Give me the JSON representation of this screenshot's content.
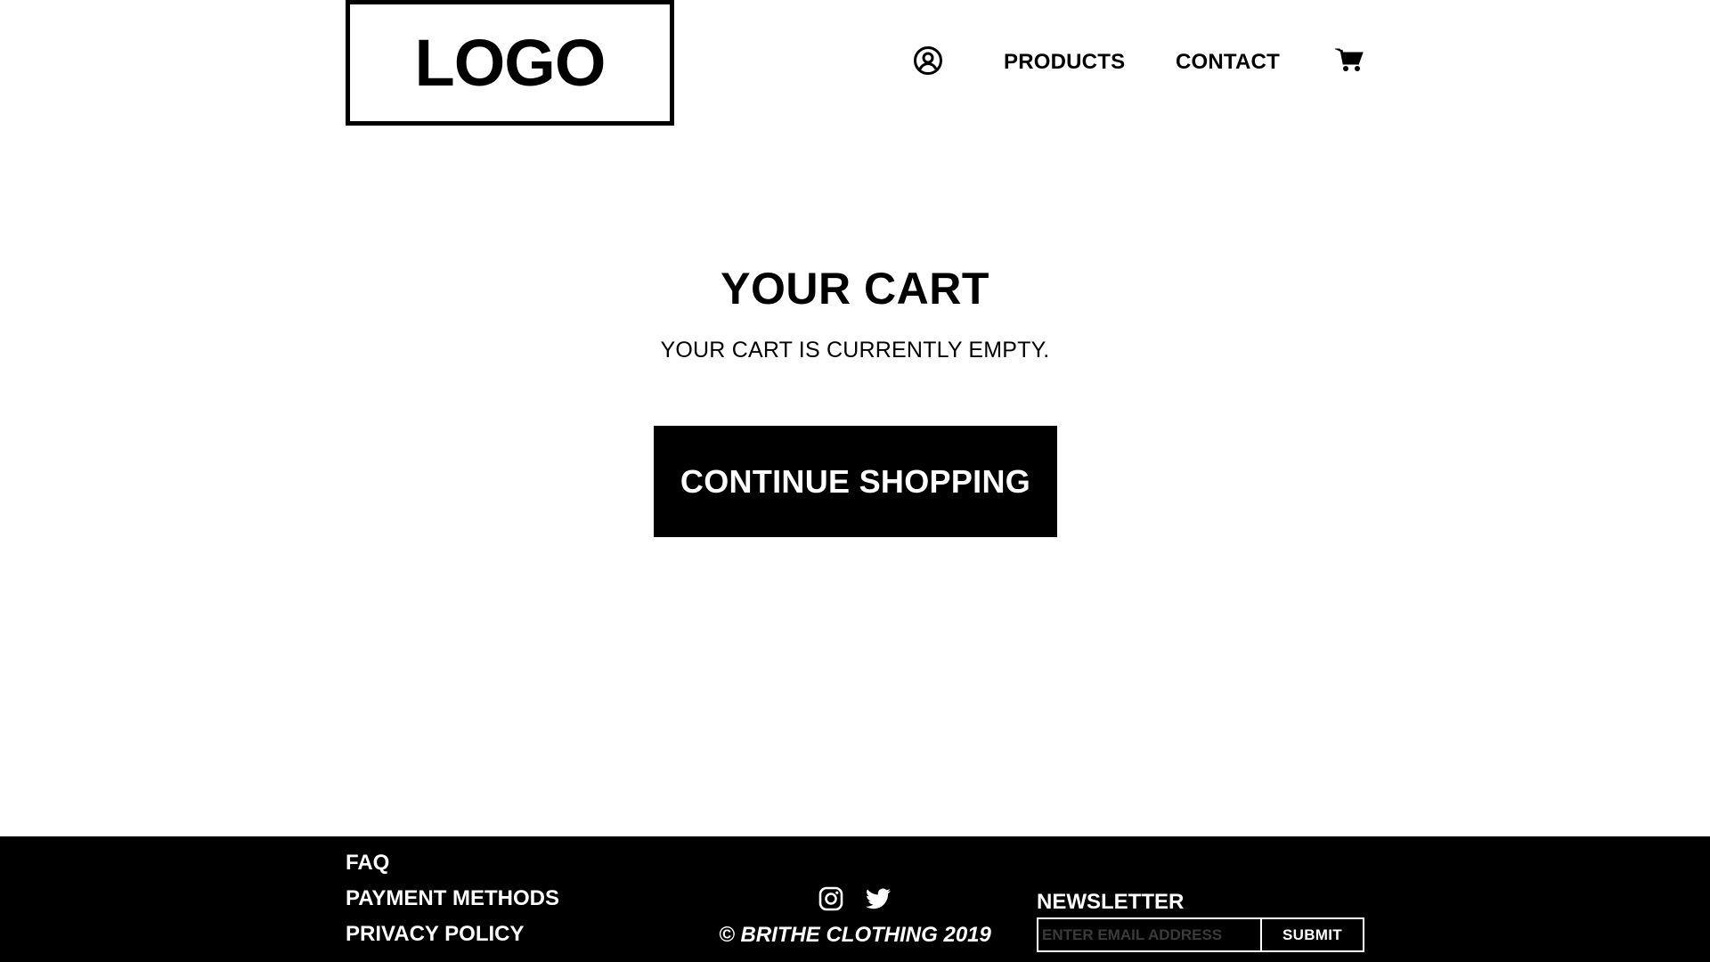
{
  "header": {
    "logo_text": "LOGO",
    "account_icon": "user-circle-icon",
    "nav": {
      "products": "PRODUCTS",
      "contact": "CONTACT"
    },
    "cart_icon": "cart-icon"
  },
  "main": {
    "title": "YOUR CART",
    "empty_message": "YOUR CART IS CURRENTLY EMPTY.",
    "continue_label": "CONTINUE SHOPPING"
  },
  "footer": {
    "links": {
      "faq": "FAQ",
      "payment": "PAYMENT METHODS",
      "privacy": "PRIVACY POLICY"
    },
    "social_icons": [
      "instagram-icon",
      "twitter-icon"
    ],
    "copyright": "© BRITHE CLOTHING 2019",
    "newsletter": {
      "label": "NEWSLETTER",
      "placeholder": "ENTER EMAIL ADDRESS",
      "value": "",
      "submit_label": "SUBMIT"
    }
  },
  "colors": {
    "background": "#ffffff",
    "foreground": "#000000",
    "footer_background": "#000000",
    "footer_text": "#ffffff",
    "placeholder": "#3a3a3a"
  }
}
